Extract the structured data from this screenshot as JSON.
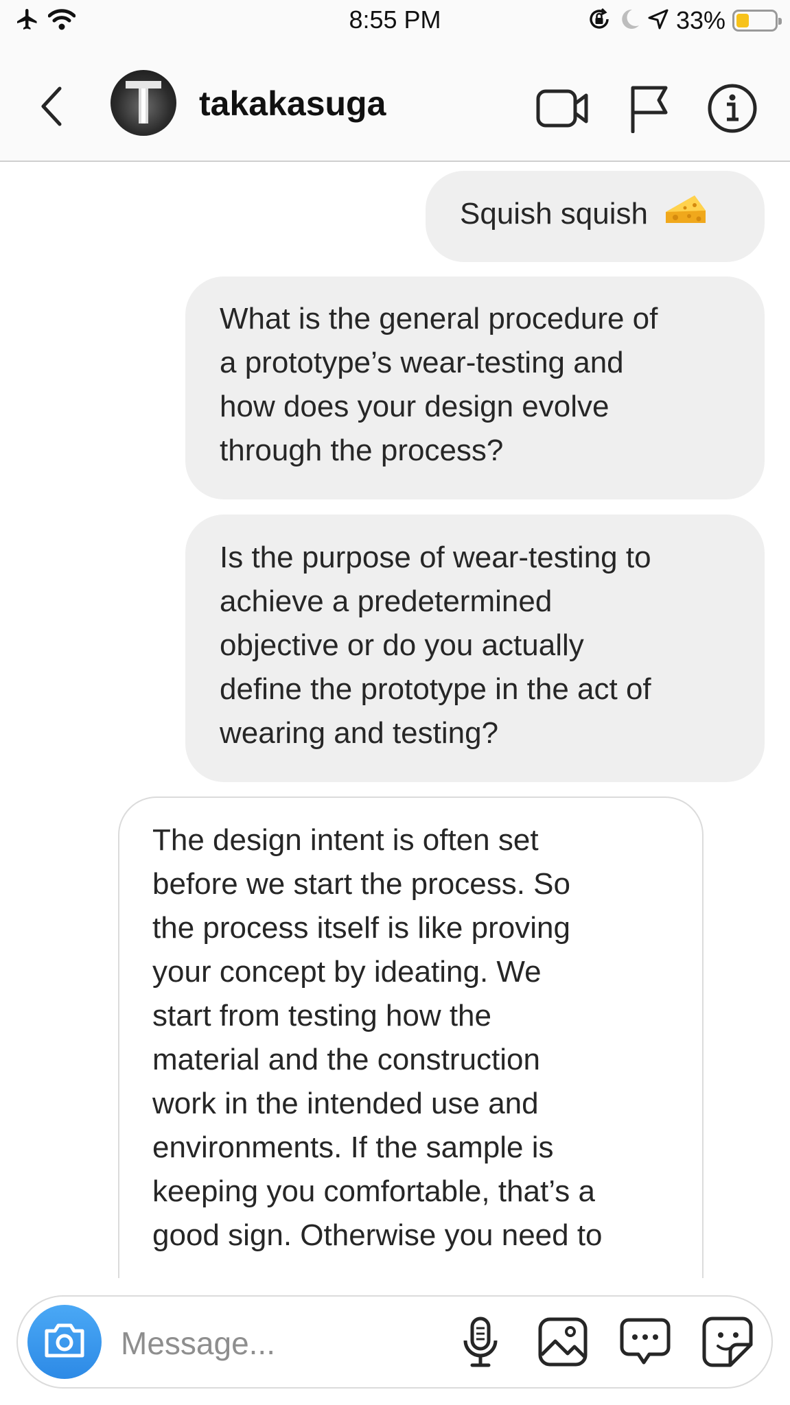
{
  "status_bar": {
    "time": "8:55 PM",
    "battery_percent": "33%",
    "battery_level": 0.33,
    "battery_fill_color": "#f7c21a",
    "icons": [
      "airplane-icon",
      "wifi-icon",
      "orientation-lock-icon",
      "moon-icon",
      "location-icon",
      "battery-icon"
    ]
  },
  "header": {
    "username": "takakasuga",
    "icons": [
      "back-chevron-icon",
      "avatar",
      "video-call-icon",
      "flag-icon",
      "info-icon"
    ]
  },
  "thread": {
    "messages": [
      {
        "direction": "sent",
        "text": "Squish squish",
        "emoji": "cheese-emoji"
      },
      {
        "direction": "sent",
        "text": "What is the general procedure of\na prototype’s wear-testing and\nhow does your design evolve\nthrough the process?"
      },
      {
        "direction": "sent",
        "text": "Is the purpose of wear-testing to\nachieve a predetermined\nobjective or do you actually\ndefine the prototype in the act of\nwearing and testing?"
      },
      {
        "direction": "received",
        "text": "The design intent is often set\nbefore we start the process. So\nthe process itself is like proving\nyour concept by ideating. We\nstart from testing how the\nmaterial and the construction\nwork in the intended use and\nenvironments. If the sample is\nkeeping you comfortable, that’s a\ngood sign. Otherwise you need to"
      }
    ]
  },
  "composer": {
    "placeholder": "Message...",
    "value": "",
    "camera_color": "#3897f0",
    "icons": [
      "camera-icon",
      "microphone-icon",
      "gallery-icon",
      "chat-bubble-icon",
      "sticker-icon"
    ]
  }
}
